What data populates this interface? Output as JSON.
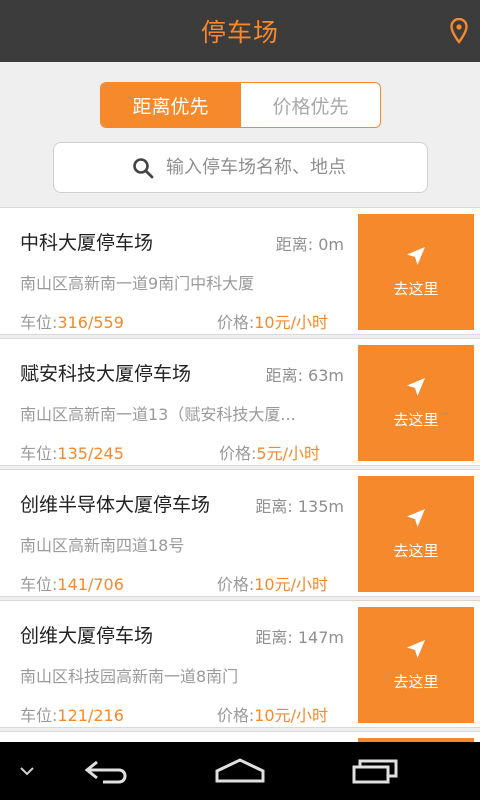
{
  "header": {
    "title": "停车场",
    "location_icon": "location-pin-icon"
  },
  "sort_tabs": [
    {
      "label": "距离优先",
      "active": true
    },
    {
      "label": "价格优先",
      "active": false
    }
  ],
  "search": {
    "placeholder": "输入停车场名称、地点",
    "value": "",
    "icon": "search-icon"
  },
  "parking_lots": [
    {
      "name": "中科大厦停车场",
      "distance_label": "距离: ",
      "distance": "0m",
      "address": "南山区高新南一道9南门中科大厦",
      "spots_label": "车位:",
      "spots": "316/559",
      "price_label": "价格:",
      "price": "10元/小时",
      "go_label": "去这里"
    },
    {
      "name": "赋安科技大厦停车场",
      "distance_label": "距离: ",
      "distance": "63m",
      "address": "南山区高新南一道13（赋安科技大厦...",
      "spots_label": "车位:",
      "spots": "135/245",
      "price_label": "价格:",
      "price": "5元/小时",
      "go_label": "去这里"
    },
    {
      "name": "创维半导体大厦停车场",
      "distance_label": "距离: ",
      "distance": "135m",
      "address": "南山区高新南四道18号",
      "spots_label": "车位:",
      "spots": "141/706",
      "price_label": "价格:",
      "price": "10元/小时",
      "go_label": "去这里"
    },
    {
      "name": "创维大厦停车场",
      "distance_label": "距离: ",
      "distance": "147m",
      "address": "南山区科技园高新南一道8南门",
      "spots_label": "车位:",
      "spots": "121/216",
      "price_label": "价格:",
      "price": "10元/小时",
      "go_label": "去这里"
    }
  ],
  "colors": {
    "accent": "#f5892b",
    "topbar": "#3c3c3c",
    "background": "#efefef"
  },
  "system_nav": {
    "icons": [
      "chevron-down-icon",
      "back-icon",
      "home-icon",
      "recent-apps-icon"
    ]
  }
}
